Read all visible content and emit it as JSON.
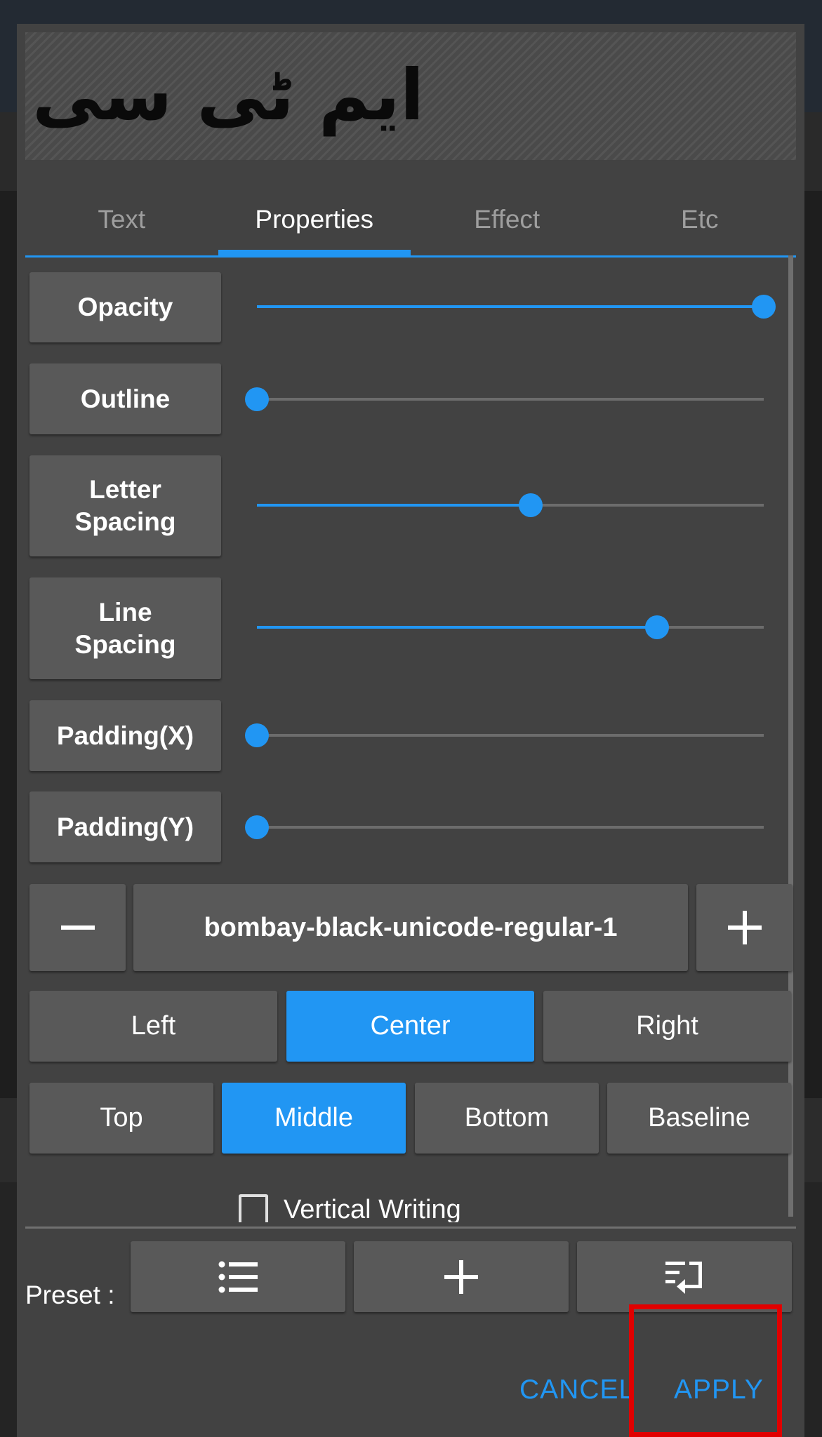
{
  "preview": {
    "text": "ایم ٹی سی"
  },
  "tabs": [
    {
      "label": "Text",
      "active": false
    },
    {
      "label": "Properties",
      "active": true
    },
    {
      "label": "Effect",
      "active": false
    },
    {
      "label": "Etc",
      "active": false
    }
  ],
  "sliders": [
    {
      "label": "Opacity",
      "value": 1.0
    },
    {
      "label": "Outline",
      "value": 0.0
    },
    {
      "label_line1": "Letter",
      "label_line2": "Spacing",
      "value": 0.54
    },
    {
      "label_line1": "Line",
      "label_line2": "Spacing",
      "value": 0.79
    },
    {
      "label": "Padding(X)",
      "value": 0.0
    },
    {
      "label": "Padding(Y)",
      "value": 0.0
    }
  ],
  "font": {
    "name": "bombay-black-unicode-regular-1",
    "decrease_icon": "minus-icon",
    "increase_icon": "plus-icon"
  },
  "horizontal_align": {
    "options": [
      "Left",
      "Center",
      "Right"
    ],
    "selected": "Center"
  },
  "vertical_align": {
    "options": [
      "Top",
      "Middle",
      "Bottom",
      "Baseline"
    ],
    "selected": "Middle"
  },
  "vertical_writing": {
    "label": "Vertical Writing",
    "checked": false
  },
  "preset": {
    "label": "Preset :",
    "buttons": [
      "list-icon",
      "plus-icon",
      "import-icon"
    ]
  },
  "actions": {
    "cancel": "CANCEL",
    "apply": "APPLY"
  },
  "colors": {
    "accent": "#2196f3",
    "dialog_bg": "#424242",
    "button_bg": "#595959",
    "highlight": "#e00000"
  }
}
